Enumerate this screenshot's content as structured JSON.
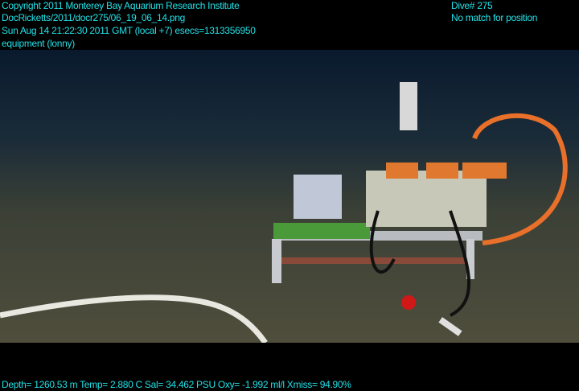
{
  "header": {
    "copyright": "Copyright 2011 Monterey Bay Aquarium Research Institute",
    "file_path": "DocRicketts/2011/docr275/06_19_06_14.png",
    "timestamp": "Sun Aug 14 21:22:30 2011 GMT (local +7)  esecs=1313356950",
    "category": "equipment (lonny)",
    "dive": "Dive# 275",
    "position_status": "No match for position"
  },
  "footer": {
    "sensor_readout": "Depth= 1260.53 m  Temp= 2.880 C  Sal= 34.462 PSU  Oxy= -1.992 ml/l  Xmiss= 94.90%"
  },
  "colors": {
    "overlay_text": "#22e0e6",
    "seafloor": "#4a4c3a",
    "water": "#0f2238",
    "cable": "#e8702a"
  }
}
